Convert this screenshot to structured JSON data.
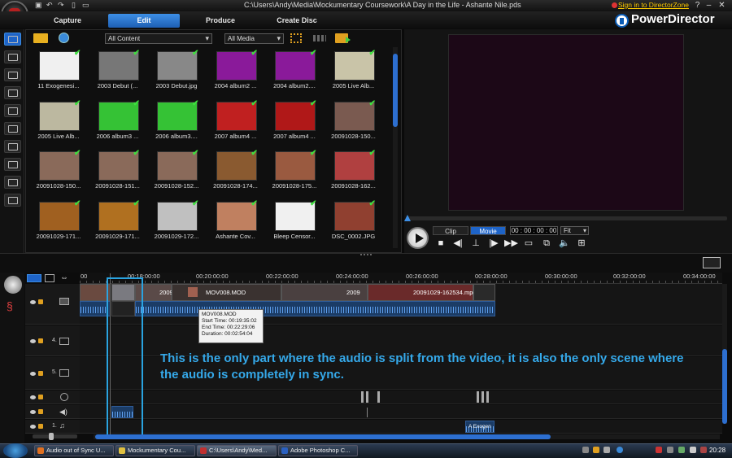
{
  "window": {
    "title": "C:\\Users\\Andy\\Media\\Mockumentary Coursework\\A Day in the Life - Ashante Nile.pds",
    "signin": "Sign in to DirectorZone",
    "brand": "PowerDirector"
  },
  "tabs": [
    {
      "label": "Capture"
    },
    {
      "label": "Edit"
    },
    {
      "label": "Produce"
    },
    {
      "label": "Create Disc"
    }
  ],
  "library": {
    "filter1": "All Content",
    "filter2": "All Media",
    "items": [
      {
        "label": "11 Exogenesi...",
        "color": "#f0f0f0"
      },
      {
        "label": "2003 Debut (...",
        "color": "#777"
      },
      {
        "label": "2003 Debut.jpg",
        "color": "#888"
      },
      {
        "label": "2004 album2 ...",
        "color": "#8a1a9a"
      },
      {
        "label": "2004 album2....",
        "color": "#8a1a9a"
      },
      {
        "label": "2005 Live Alb...",
        "color": "#c9c4a8"
      },
      {
        "label": "2005 Live Alb...",
        "color": "#bcb8a0"
      },
      {
        "label": "2006 album3 ...",
        "color": "#35c235"
      },
      {
        "label": "2006 album3....",
        "color": "#35c235"
      },
      {
        "label": "2007 album4 ...",
        "color": "#c02020"
      },
      {
        "label": "2007 album4 ...",
        "color": "#b01818"
      },
      {
        "label": "20091028-150...",
        "color": "#7a5a50"
      },
      {
        "label": "20091028-150...",
        "color": "#8a6a5a"
      },
      {
        "label": "20091028-151...",
        "color": "#8a6a5a"
      },
      {
        "label": "20091028-152...",
        "color": "#8a6a5a"
      },
      {
        "label": "20091028-174...",
        "color": "#8a5a30"
      },
      {
        "label": "20091028-175...",
        "color": "#9a5a40"
      },
      {
        "label": "20091028-162...",
        "color": "#b04040"
      },
      {
        "label": "20091029-171...",
        "color": "#a06020"
      },
      {
        "label": "20091029-171...",
        "color": "#b07020"
      },
      {
        "label": "20091029-172...",
        "color": "#c0c0c0"
      },
      {
        "label": "Ashante Cov...",
        "color": "#c08060"
      },
      {
        "label": "Bleep Censor...",
        "color": "#f0f0f0"
      },
      {
        "label": "DSC_0002.JPG",
        "color": "#904030"
      }
    ]
  },
  "preview": {
    "mode_clip": "Clip",
    "mode_movie": "Movie",
    "timecode": "00 : 00 : 00 : 00",
    "fit": "Fit"
  },
  "timeline": {
    "ruler": [
      "00",
      "00:18:00:00",
      "00:20:00:00",
      "00:22:00:00",
      "00:24:00:00",
      "00:26:00:00",
      "00:28:00:00",
      "00:30:00:00",
      "00:32:00:00",
      "00:34:00:00"
    ],
    "track4": "4.",
    "track5": "5.",
    "track1": "1.",
    "clip_mov008": "MOV008.MOD",
    "clip_2009a": "2009",
    "clip_2009b": "2009",
    "clip_last": "20091029-162534.mpg",
    "audio_clip": "A Exogen",
    "tooltip": {
      "name": "MOV008.MOD",
      "start": "Start Time: 00:19:35:02",
      "end": "End Time: 00:22:29:06",
      "duration": "Duration: 00:02:54:04"
    }
  },
  "annotation": "This is the only part where the audio is split from the video, it is also the only scene where the audio is completely in sync.",
  "taskbar": {
    "items": [
      {
        "label": "Audio out of Sync U...",
        "color": "#e07020"
      },
      {
        "label": "Mockumentary Cou...",
        "color": "#e0c040"
      },
      {
        "label": "C:\\Users\\Andy\\Med...",
        "color": "#c03030"
      },
      {
        "label": "Adobe Photoshop C...",
        "color": "#2a60c0"
      }
    ],
    "clock": "20:28"
  }
}
